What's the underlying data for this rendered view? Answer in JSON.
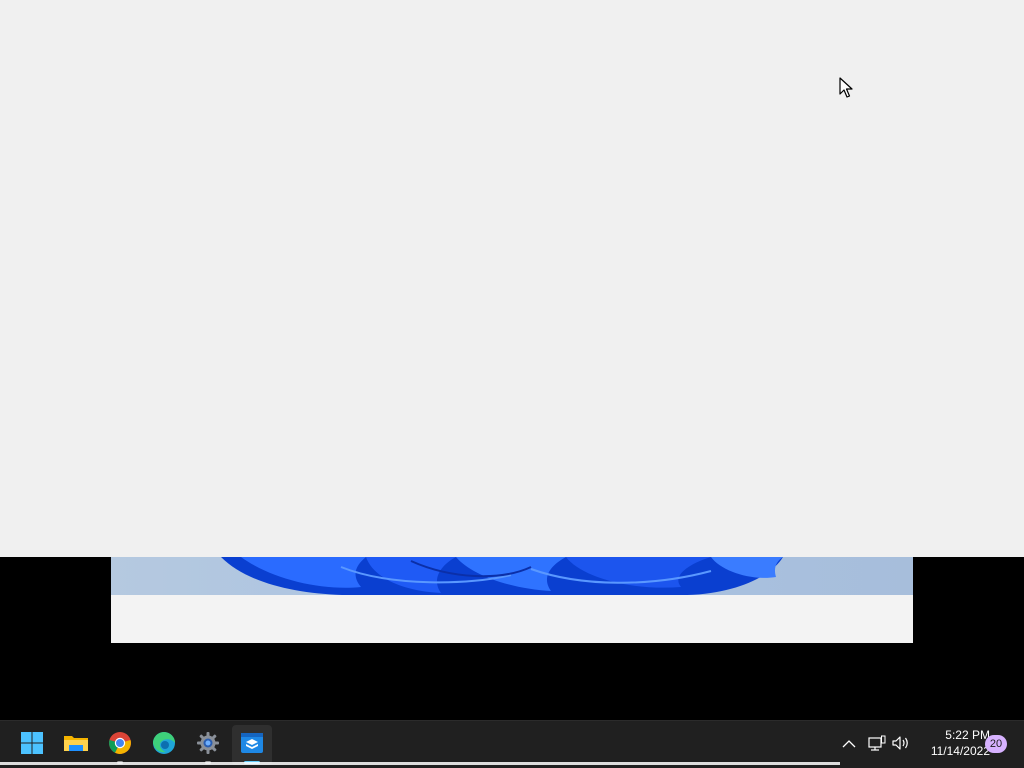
{
  "taskbar": {
    "apps": [
      {
        "name": "Start",
        "icon": "windows-start-icon"
      },
      {
        "name": "File Explorer",
        "icon": "file-explorer-icon"
      },
      {
        "name": "Google Chrome",
        "icon": "chrome-icon"
      },
      {
        "name": "Microsoft Edge",
        "icon": "edge-icon"
      },
      {
        "name": "Settings",
        "icon": "gear-icon"
      },
      {
        "name": "Window app",
        "icon": "window-app-icon"
      }
    ],
    "tray": {
      "chevron_icon": "chevron-up-icon",
      "network_icon": "network-icon",
      "volume_icon": "volume-icon"
    },
    "clock": {
      "time": "5:22 PM",
      "date": "11/14/2022"
    },
    "notification_count": "20"
  },
  "colors": {
    "app_background": "#f0f0f0",
    "taskbar": "#202020",
    "accent": "#60cdff",
    "badge": "#d7b2ff"
  }
}
